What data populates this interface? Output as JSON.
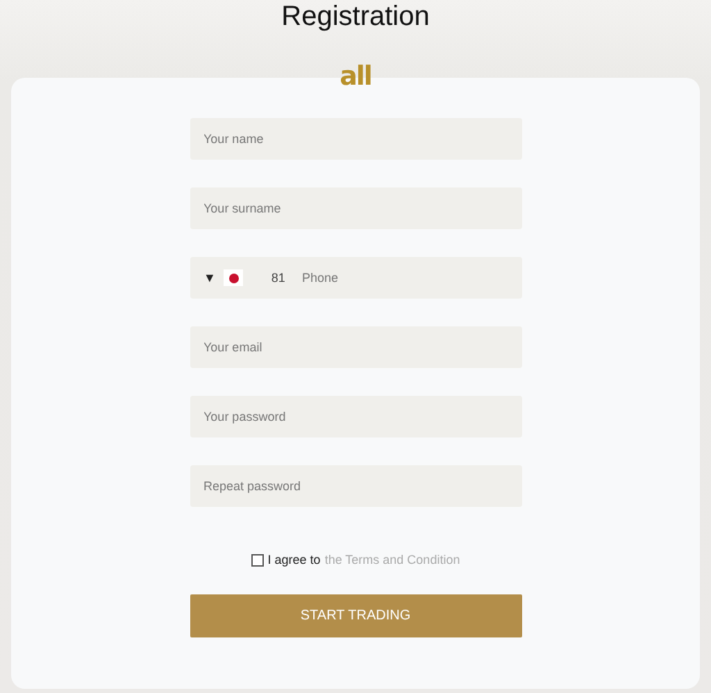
{
  "title": "Registration",
  "logo": "all",
  "fields": [
    {
      "kind": "text",
      "placeholder": "Your name"
    },
    {
      "kind": "text",
      "placeholder": "Your surname"
    },
    {
      "kind": "phone",
      "caret": "▼",
      "code": "81",
      "placeholder": "Phone"
    },
    {
      "kind": "text",
      "placeholder": "Your email"
    },
    {
      "kind": "password",
      "placeholder": "Your password"
    },
    {
      "kind": "password",
      "placeholder": "Repeat password"
    }
  ],
  "agree": {
    "checked": false,
    "text": "I agree to",
    "link": "the Terms and Condition"
  },
  "button": "START TRADING"
}
